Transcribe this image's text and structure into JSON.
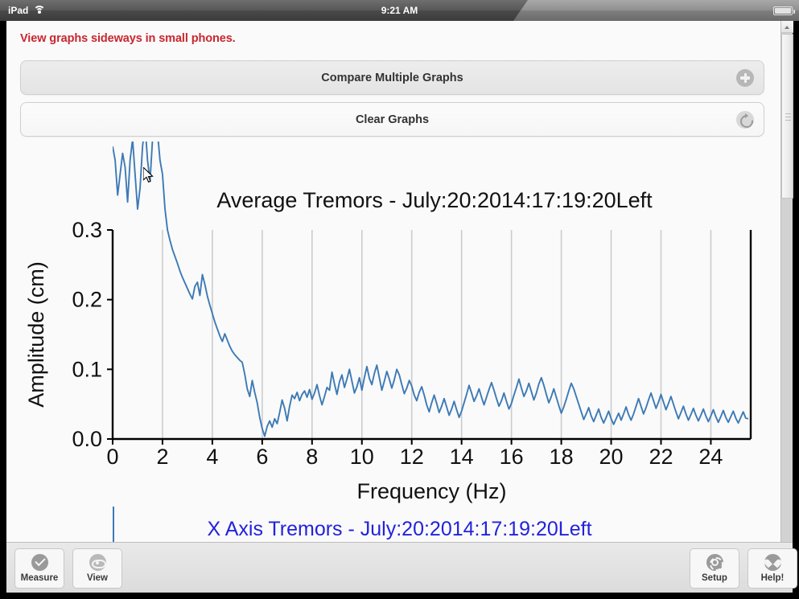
{
  "status_bar": {
    "device": "iPad",
    "wifi_icon": "wifi-icon",
    "time": "9:21 AM",
    "battery_percent": "100%",
    "battery_icon": "battery-icon"
  },
  "notice": {
    "text": "View graphs sideways in small phones.",
    "color": "#c9262f"
  },
  "actions": [
    {
      "label": "Compare Multiple Graphs",
      "icon": "plus-circle-icon"
    },
    {
      "label": "Clear Graphs",
      "icon": "refresh-circle-icon"
    }
  ],
  "bottom_graph": {
    "title": "X Axis Tremors - July:20:2014:17:19:20Left",
    "color": "#2222dd"
  },
  "toolbar": [
    {
      "label": "Measure",
      "icon": "check-circle-icon"
    },
    {
      "label": "View",
      "icon": "eye-icon"
    },
    {
      "label": "Setup",
      "icon": "gear-icon"
    },
    {
      "label": "Help!",
      "icon": "heart-icon"
    }
  ],
  "scrollbar": {
    "up_arrow_icon": "caret-up-icon",
    "grip_icon": "grip-lines-icon"
  },
  "chart_data": {
    "type": "line",
    "title": "Average Tremors - July:20:2014:17:19:20Left",
    "xlabel": "Frequency (Hz)",
    "ylabel": "Amplitude (cm)",
    "xlim": [
      0,
      25.6
    ],
    "ylim": [
      0.0,
      0.3
    ],
    "xticks": [
      0,
      2,
      4,
      6,
      8,
      10,
      12,
      14,
      16,
      18,
      20,
      22,
      24
    ],
    "yticks": [
      0.0,
      0.1,
      0.2,
      0.3
    ],
    "grid": "vertical-only",
    "legend": "none",
    "line_color": "#3d7ab5",
    "x": [
      0.0,
      0.1,
      0.2,
      0.3,
      0.4,
      0.5,
      0.6,
      0.7,
      0.8,
      0.9,
      1.0,
      1.1,
      1.2,
      1.3,
      1.4,
      1.5,
      1.6,
      1.7,
      1.8,
      1.9,
      2.0,
      2.1,
      2.2,
      2.3,
      2.4,
      2.5,
      2.6,
      2.7,
      2.8,
      2.9,
      3.0,
      3.1,
      3.2,
      3.3,
      3.4,
      3.5,
      3.6,
      3.7,
      3.8,
      3.9,
      4.0,
      4.1,
      4.2,
      4.3,
      4.4,
      4.5,
      4.6,
      4.7,
      4.8,
      4.9,
      5.0,
      5.1,
      5.2,
      5.3,
      5.4,
      5.5,
      5.6,
      5.7,
      5.8,
      5.9,
      6.0,
      6.1,
      6.2,
      6.3,
      6.4,
      6.5,
      6.6,
      6.7,
      6.8,
      6.9,
      7.0,
      7.1,
      7.2,
      7.3,
      7.4,
      7.5,
      7.6,
      7.7,
      7.8,
      7.9,
      8.0,
      8.1,
      8.2,
      8.3,
      8.4,
      8.5,
      8.6,
      8.7,
      8.8,
      8.9,
      9.0,
      9.1,
      9.2,
      9.3,
      9.4,
      9.5,
      9.6,
      9.7,
      9.8,
      9.9,
      10.0,
      10.1,
      10.2,
      10.3,
      10.4,
      10.5,
      10.6,
      10.7,
      10.8,
      10.9,
      11.0,
      11.1,
      11.2,
      11.3,
      11.4,
      11.5,
      11.6,
      11.7,
      11.8,
      11.9,
      12.0,
      12.1,
      12.2,
      12.3,
      12.4,
      12.5,
      12.6,
      12.7,
      12.8,
      12.9,
      13.0,
      13.1,
      13.2,
      13.3,
      13.4,
      13.5,
      13.6,
      13.7,
      13.8,
      13.9,
      14.0,
      14.1,
      14.2,
      14.3,
      14.4,
      14.5,
      14.6,
      14.7,
      14.8,
      14.9,
      15.0,
      15.1,
      15.2,
      15.3,
      15.4,
      15.5,
      15.6,
      15.7,
      15.8,
      15.9,
      16.0,
      16.1,
      16.2,
      16.3,
      16.4,
      16.5,
      16.6,
      16.7,
      16.8,
      16.9,
      17.0,
      17.1,
      17.2,
      17.3,
      17.4,
      17.5,
      17.6,
      17.7,
      17.8,
      17.9,
      18.0,
      18.1,
      18.2,
      18.3,
      18.4,
      18.5,
      18.6,
      18.7,
      18.8,
      18.9,
      19.0,
      19.1,
      19.2,
      19.3,
      19.4,
      19.5,
      19.6,
      19.7,
      19.8,
      19.9,
      20.0,
      20.1,
      20.2,
      20.3,
      20.4,
      20.5,
      20.6,
      20.7,
      20.8,
      20.9,
      21.0,
      21.1,
      21.2,
      21.3,
      21.4,
      21.5,
      21.6,
      21.7,
      21.8,
      21.9,
      22.0,
      22.1,
      22.2,
      22.3,
      22.4,
      22.5,
      22.6,
      22.7,
      22.8,
      22.9,
      23.0,
      23.1,
      23.2,
      23.3,
      23.4,
      23.5,
      23.6,
      23.7,
      23.8,
      23.9,
      24.0,
      24.1,
      24.2,
      24.3,
      24.4,
      24.5,
      24.6,
      24.7,
      24.8,
      24.9,
      25.0,
      25.1,
      25.2,
      25.3,
      25.4,
      25.5
    ],
    "y": [
      0.42,
      0.4,
      0.35,
      0.38,
      0.41,
      0.39,
      0.34,
      0.4,
      0.43,
      0.38,
      0.33,
      0.36,
      0.42,
      0.45,
      0.4,
      0.37,
      0.43,
      0.47,
      0.44,
      0.4,
      0.38,
      0.33,
      0.3,
      0.285,
      0.272,
      0.262,
      0.252,
      0.241,
      0.232,
      0.224,
      0.216,
      0.208,
      0.201,
      0.219,
      0.225,
      0.206,
      0.236,
      0.222,
      0.205,
      0.192,
      0.18,
      0.168,
      0.158,
      0.148,
      0.14,
      0.151,
      0.142,
      0.133,
      0.126,
      0.121,
      0.117,
      0.113,
      0.11,
      0.093,
      0.072,
      0.061,
      0.084,
      0.067,
      0.052,
      0.031,
      0.015,
      0.004,
      0.018,
      0.026,
      0.017,
      0.029,
      0.022,
      0.038,
      0.056,
      0.044,
      0.026,
      0.047,
      0.063,
      0.058,
      0.067,
      0.055,
      0.064,
      0.069,
      0.06,
      0.071,
      0.057,
      0.066,
      0.078,
      0.062,
      0.049,
      0.061,
      0.074,
      0.07,
      0.096,
      0.079,
      0.064,
      0.082,
      0.092,
      0.074,
      0.086,
      0.1,
      0.083,
      0.066,
      0.075,
      0.088,
      0.07,
      0.088,
      0.104,
      0.087,
      0.078,
      0.094,
      0.106,
      0.088,
      0.07,
      0.083,
      0.097,
      0.086,
      0.073,
      0.085,
      0.1,
      0.092,
      0.078,
      0.065,
      0.073,
      0.084,
      0.076,
      0.063,
      0.055,
      0.067,
      0.075,
      0.063,
      0.049,
      0.039,
      0.052,
      0.063,
      0.051,
      0.038,
      0.047,
      0.058,
      0.046,
      0.034,
      0.043,
      0.054,
      0.042,
      0.031,
      0.04,
      0.052,
      0.064,
      0.077,
      0.066,
      0.054,
      0.062,
      0.072,
      0.06,
      0.049,
      0.06,
      0.071,
      0.081,
      0.07,
      0.058,
      0.047,
      0.055,
      0.066,
      0.054,
      0.043,
      0.051,
      0.063,
      0.074,
      0.086,
      0.073,
      0.061,
      0.069,
      0.08,
      0.068,
      0.056,
      0.066,
      0.079,
      0.088,
      0.077,
      0.064,
      0.052,
      0.061,
      0.072,
      0.06,
      0.048,
      0.037,
      0.046,
      0.057,
      0.069,
      0.08,
      0.072,
      0.061,
      0.05,
      0.039,
      0.028,
      0.036,
      0.045,
      0.033,
      0.025,
      0.034,
      0.043,
      0.031,
      0.023,
      0.031,
      0.04,
      0.029,
      0.021,
      0.029,
      0.037,
      0.027,
      0.036,
      0.046,
      0.035,
      0.027,
      0.036,
      0.047,
      0.058,
      0.047,
      0.036,
      0.045,
      0.056,
      0.066,
      0.055,
      0.044,
      0.053,
      0.064,
      0.053,
      0.042,
      0.051,
      0.061,
      0.05,
      0.039,
      0.029,
      0.038,
      0.047,
      0.036,
      0.027,
      0.035,
      0.044,
      0.034,
      0.026,
      0.034,
      0.043,
      0.033,
      0.025,
      0.033,
      0.042,
      0.032,
      0.024,
      0.032,
      0.041,
      0.031,
      0.024,
      0.032,
      0.04,
      0.03,
      0.023,
      0.031,
      0.039,
      0.03,
      0.029
    ]
  }
}
